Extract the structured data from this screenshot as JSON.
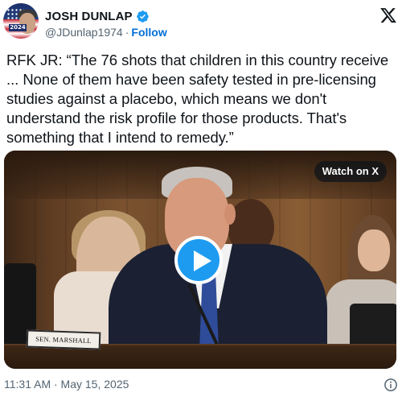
{
  "author": {
    "name": "JOSH DUNLAP",
    "handle": "@JDunlap1974",
    "separator": "·",
    "follow_label": "Follow",
    "avatar_badge": "2024",
    "verified_color": "#1d9bf0"
  },
  "brand_icon": "x-logo-icon",
  "tweet": {
    "text": "RFK JR: “The 76 shots that children in this country receive ... None of them have been safety tested in pre-licensing studies against a placebo, which means we don't understand the risk profile for those products. That's something that I intend to remedy.”"
  },
  "media": {
    "watch_label": "Watch on X",
    "nameplate": "SEN. MARSHALL",
    "play_icon": "play-icon",
    "play_color": "#1d9bf0"
  },
  "footer": {
    "timestamp": "11:31 AM · May 15, 2025",
    "info_icon": "info-icon"
  }
}
